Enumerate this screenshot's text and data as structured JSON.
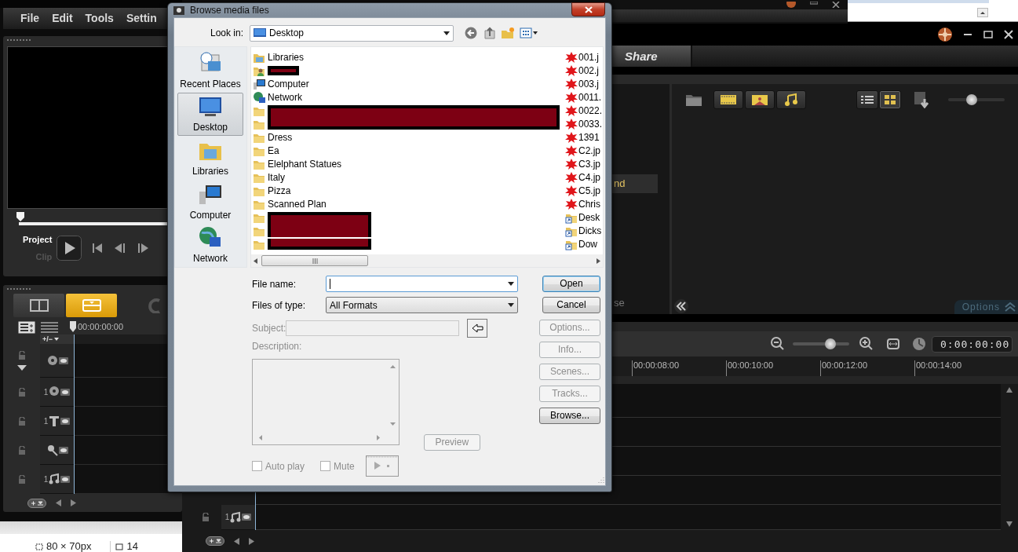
{
  "left_window": {
    "menu": [
      "File",
      "Edit",
      "Tools",
      "Settin"
    ],
    "scrubber": {
      "level": 0
    },
    "preview_modes": [
      {
        "label": "Project",
        "selected": true
      },
      {
        "label": "Clip",
        "selected": false
      }
    ],
    "view_tabs": [
      {
        "kind": "storyboard",
        "selected": false
      },
      {
        "kind": "timeline",
        "selected": true
      }
    ],
    "timecode": "00:00:00:00",
    "track_toggle": "+/−",
    "tracks": [
      {
        "kind": "video"
      },
      {
        "kind": "overlay",
        "number": "1"
      },
      {
        "kind": "title",
        "number": "1"
      },
      {
        "kind": "voice"
      },
      {
        "kind": "music",
        "number": "1"
      }
    ],
    "status": [
      "80 × 70px",
      "14"
    ]
  },
  "right_window": {
    "tabs": [
      {
        "label": "Share"
      }
    ],
    "library_items": [
      {
        "label": "nd",
        "selected": true
      },
      {
        "label": "se",
        "selected": false
      }
    ],
    "media_filters": [
      {
        "kind": "video"
      },
      {
        "kind": "photo"
      },
      {
        "kind": "audio"
      }
    ],
    "views": [
      {
        "kind": "list",
        "selected": false
      },
      {
        "kind": "thumbnails",
        "selected": true
      }
    ],
    "thumbnail_size": {
      "level": 0.42
    },
    "options_label": "Options",
    "zoom": {
      "level": 0.67
    },
    "timecode": "0:00:00:00",
    "ruler": [
      "00:00:08:00",
      "00:00:10:00",
      "00:00:12:00",
      "00:00:14:00"
    ],
    "bottom_track": {
      "kind": "music",
      "number": "1"
    }
  },
  "dialog": {
    "title": "Browse media files",
    "look_in": {
      "label": "Look in:",
      "value": "Desktop"
    },
    "places": [
      {
        "label": "Recent Places",
        "kind": "recent",
        "selected": false
      },
      {
        "label": "Desktop",
        "kind": "desktop",
        "selected": true
      },
      {
        "label": "Libraries",
        "kind": "libraries",
        "selected": false
      },
      {
        "label": "Computer",
        "kind": "computer",
        "selected": false
      },
      {
        "label": "Network",
        "kind": "network",
        "selected": false
      }
    ],
    "files": [
      {
        "kind": "libraries",
        "name": "Libraries"
      },
      {
        "kind": "user",
        "redacted": true
      },
      {
        "kind": "computer",
        "name": "Computer"
      },
      {
        "kind": "network",
        "name": "Network"
      },
      {
        "kind": "folder",
        "redacted": true
      },
      {
        "kind": "folder",
        "redacted": true
      },
      {
        "kind": "folder",
        "name": "Dress"
      },
      {
        "kind": "folder",
        "name": "Ea"
      },
      {
        "kind": "folder",
        "name": "Elelphant Statues"
      },
      {
        "kind": "folder",
        "name": "Italy"
      },
      {
        "kind": "folder",
        "name": "Pizza"
      },
      {
        "kind": "folder",
        "name": "Scanned Plan"
      },
      {
        "kind": "folder",
        "redacted": true
      },
      {
        "kind": "folder",
        "redacted": true
      },
      {
        "kind": "folder",
        "redacted": true
      }
    ],
    "files_column_2": [
      {
        "kind": "image",
        "name": "001.j"
      },
      {
        "kind": "image",
        "name": "002.j"
      },
      {
        "kind": "image",
        "name": "003.j"
      },
      {
        "kind": "image",
        "name": "0011."
      },
      {
        "kind": "image",
        "name": "0022."
      },
      {
        "kind": "image",
        "name": "0033."
      },
      {
        "kind": "image",
        "name": "1391"
      },
      {
        "kind": "image",
        "name": "C2.jp"
      },
      {
        "kind": "image",
        "name": "C3.jp"
      },
      {
        "kind": "image",
        "name": "C4.jp"
      },
      {
        "kind": "image",
        "name": "C5.jp"
      },
      {
        "kind": "image",
        "name": "Chris"
      },
      {
        "kind": "shortcut",
        "name": "Desk"
      },
      {
        "kind": "shortcut",
        "name": "Dicks"
      },
      {
        "kind": "shortcut",
        "name": "Dow"
      }
    ],
    "file_name": {
      "label": "File name:"
    },
    "file_type": {
      "label": "Files of type:",
      "value": "All Formats"
    },
    "buttons": [
      {
        "label": "Open",
        "default": true
      },
      {
        "label": "Cancel",
        "default": false
      }
    ],
    "subject": {
      "label": "Subject:",
      "disabled": true
    },
    "description": {
      "label": "Description:",
      "disabled": true
    },
    "side_buttons": [
      {
        "label": "Options...",
        "disabled": true
      },
      {
        "label": "Info...",
        "disabled": true
      },
      {
        "label": "Scenes...",
        "disabled": true
      },
      {
        "label": "Tracks...",
        "disabled": true
      },
      {
        "label": "Browse...",
        "disabled": false
      }
    ],
    "preview_button": {
      "label": "Preview",
      "disabled": true
    },
    "checkboxes": [
      {
        "label": "Auto play",
        "checked": false,
        "disabled": true
      },
      {
        "label": "Mute",
        "checked": false,
        "disabled": true
      }
    ]
  }
}
